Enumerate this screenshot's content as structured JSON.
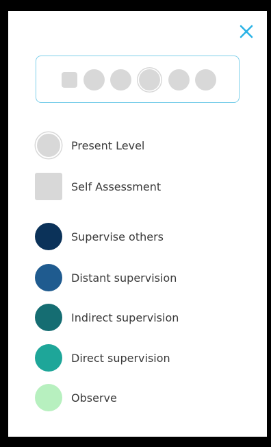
{
  "levels": [
    {
      "shape": "square",
      "color": "#d8d8d8"
    },
    {
      "shape": "circle",
      "color": "#d8d8d8"
    },
    {
      "shape": "circle",
      "color": "#d8d8d8"
    },
    {
      "shape": "circle",
      "color": "#d8d8d8",
      "present": true
    },
    {
      "shape": "circle",
      "color": "#d8d8d8"
    },
    {
      "shape": "circle",
      "color": "#d8d8d8"
    }
  ],
  "legend": {
    "present_level": {
      "label": "Present Level",
      "color": "#d8d8d8"
    },
    "self_assessment": {
      "label": "Self Assessment",
      "color": "#d8d8d8"
    },
    "supervise_others": {
      "label": "Supervise others",
      "color": "#0b3259"
    },
    "distant_supervision": {
      "label": "Distant supervision",
      "color": "#1f5b8f"
    },
    "indirect_supervision": {
      "label": "Indirect supervision",
      "color": "#156d72"
    },
    "direct_supervision": {
      "label": "Direct supervision",
      "color": "#1ea699"
    },
    "observe": {
      "label": "Observe",
      "color": "#b7f0bf"
    }
  },
  "colors": {
    "accent": "#2bb3e6",
    "border": "#7ccfea",
    "placeholder_gray": "#d8d8d8",
    "text": "#3a3a3a"
  },
  "icons": {
    "close": "close-icon"
  }
}
